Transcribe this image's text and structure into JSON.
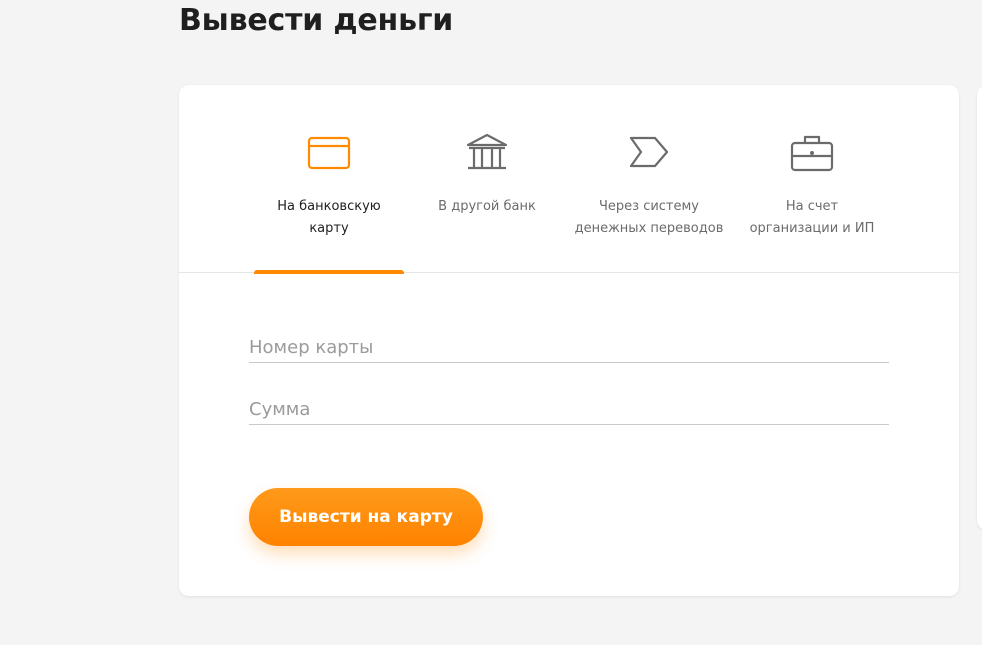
{
  "page": {
    "title": "Вывести деньги"
  },
  "colors": {
    "accent": "#ff8a00",
    "icon_inactive": "#6b6b6b",
    "text_primary": "#1f1f1f",
    "background": "#f4f4f4"
  },
  "tabs": [
    {
      "label": "На банковскую\nкарту",
      "icon": "credit-card-icon",
      "active": true
    },
    {
      "label": "В другой банк",
      "icon": "bank-icon",
      "active": false
    },
    {
      "label": "Через систему\nденежных переводов",
      "icon": "transfer-tag-icon",
      "active": false
    },
    {
      "label": "На счет\nорганизации и ИП",
      "icon": "briefcase-icon",
      "active": false
    }
  ],
  "form": {
    "card_number": {
      "placeholder": "Номер карты",
      "value": ""
    },
    "amount": {
      "placeholder": "Сумма",
      "value": ""
    },
    "submit_label": "Вывести на карту"
  }
}
